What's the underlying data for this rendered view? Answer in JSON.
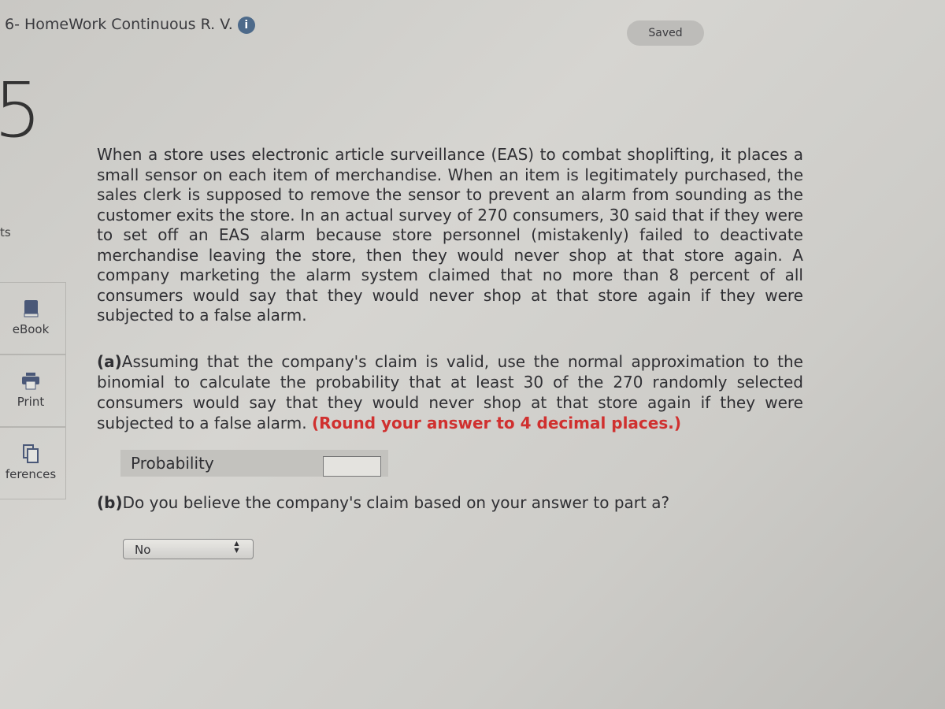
{
  "header": {
    "title": "6- HomeWork Continuous R. V.",
    "info_icon": "info-icon",
    "status": "Saved"
  },
  "question": {
    "number": "5",
    "points_label": "ts"
  },
  "sidebar": {
    "items": [
      {
        "label": "eBook",
        "icon": "book-icon"
      },
      {
        "label": "Print",
        "icon": "printer-icon"
      },
      {
        "label": "ferences",
        "icon": "references-icon"
      }
    ]
  },
  "body": {
    "text": "When a store uses electronic article surveillance (EAS) to combat shoplifting, it places a small sensor on each item of merchandise. When an item is legitimately purchased, the sales clerk is supposed to remove the sensor to prevent an alarm from sounding as the customer exits the store. In an actual survey of 270 consumers, 30 said that if they were to set off an EAS alarm because store personnel (mistakenly) failed to deactivate merchandise leaving the store, then they would never shop at that store again. A company marketing the alarm system claimed that no more than 8 percent of all consumers would say that they would never shop at that store again if they were subjected to a false alarm.",
    "part_a_label": "(a)",
    "part_a_text": "Assuming that the company's claim is valid, use the normal approximation to the binomial to calculate the probability that at least 30 of the 270 randomly selected consumers would say that they would never shop at that store again if they were subjected to a false alarm.",
    "part_a_note": "(Round your answer to 4 decimal places.)",
    "probability_label": "Probability",
    "probability_value": "",
    "part_b_label": "(b)",
    "part_b_text": "Do you believe the company's claim based on your answer to part a?",
    "part_b_selected": "No"
  },
  "colors": {
    "accent_red": "#d0302f",
    "icon_blue": "#4d6a8a"
  }
}
